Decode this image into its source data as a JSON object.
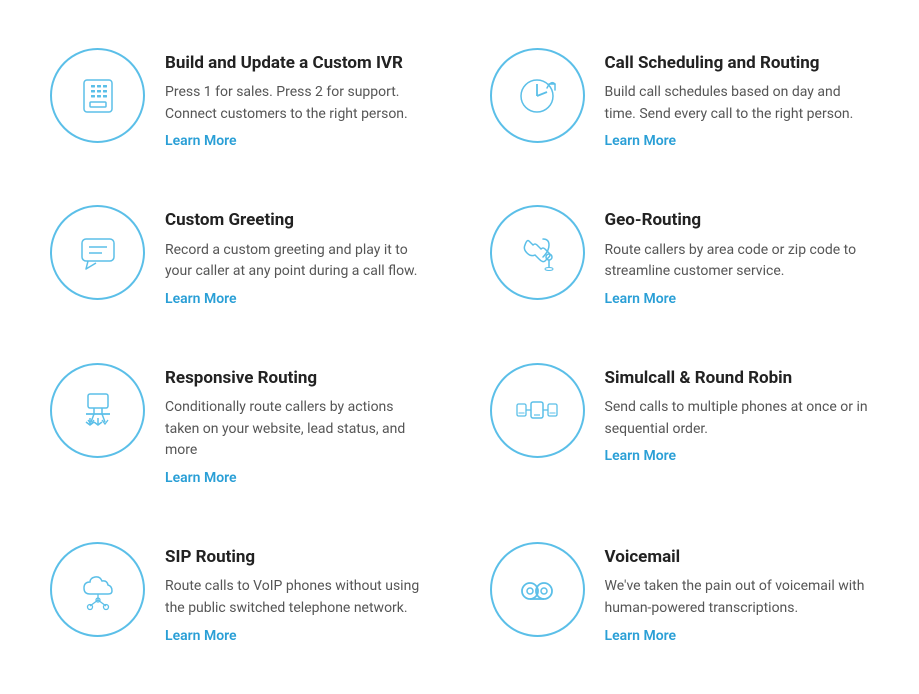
{
  "features": [
    {
      "id": "custom-ivr",
      "title": "Build and Update a Custom IVR",
      "description": "Press 1 for sales. Press 2 for support. Connect customers to the right person.",
      "learn_more": "Learn More",
      "icon": "ivr"
    },
    {
      "id": "call-scheduling",
      "title": "Call Scheduling and Routing",
      "description": "Build call schedules based on day and time. Send every call to the right person.",
      "learn_more": "Learn More",
      "icon": "clock"
    },
    {
      "id": "custom-greeting",
      "title": "Custom Greeting",
      "description": "Record a custom greeting and play it to your caller at any point during a call flow.",
      "learn_more": "Learn More",
      "icon": "chat"
    },
    {
      "id": "geo-routing",
      "title": "Geo-Routing",
      "description": "Route callers by area code or zip code to streamline customer service.",
      "learn_more": "Learn More",
      "icon": "geo"
    },
    {
      "id": "responsive-routing",
      "title": "Responsive Routing",
      "description": "Conditionally route callers by actions taken on your website, lead status, and more",
      "learn_more": "Learn More",
      "icon": "responsive"
    },
    {
      "id": "simulcall",
      "title": "Simulcall & Round Robin",
      "description": "Send calls to multiple phones at once or in sequential order.",
      "learn_more": "Learn More",
      "icon": "simulcall"
    },
    {
      "id": "sip-routing",
      "title": "SIP Routing",
      "description": "Route calls to VoIP phones without using the public switched telephone network.",
      "learn_more": "Learn More",
      "icon": "sip"
    },
    {
      "id": "voicemail",
      "title": "Voicemail",
      "description": "We've taken the pain out of voicemail with human-powered transcriptions.",
      "learn_more": "Learn More",
      "icon": "voicemail"
    }
  ]
}
